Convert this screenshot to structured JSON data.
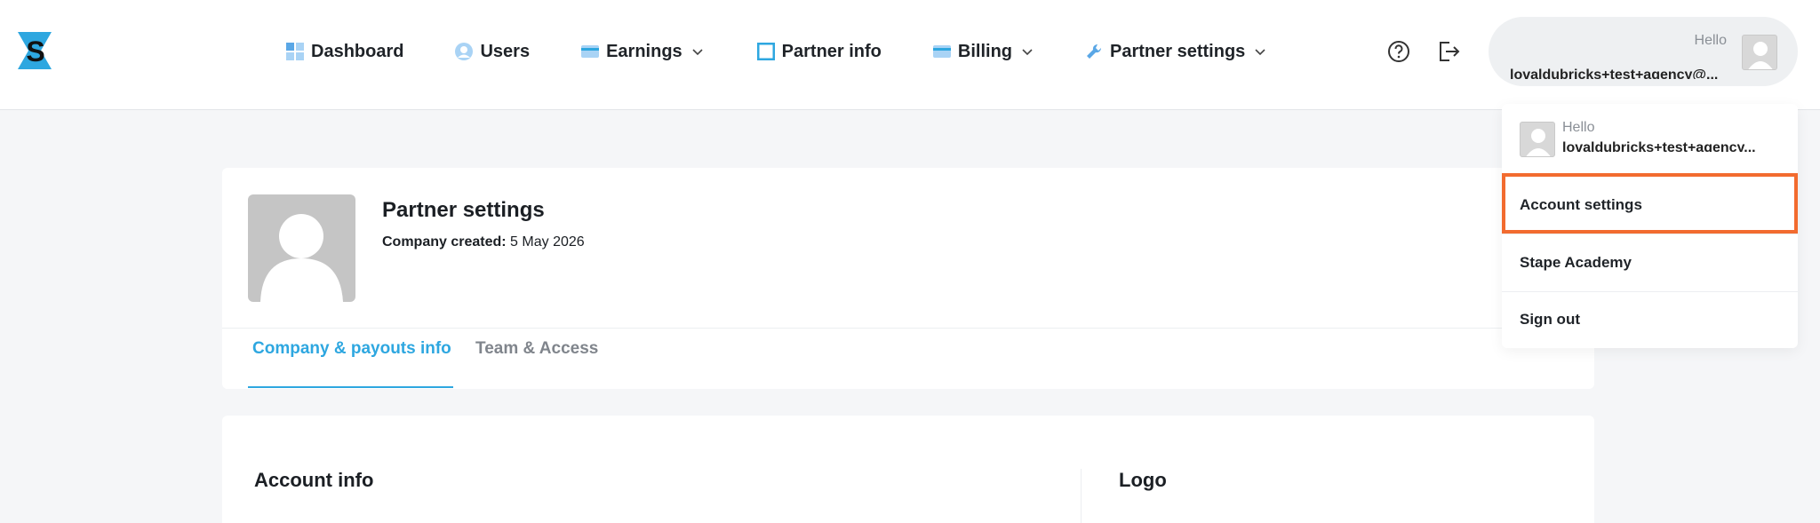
{
  "nav": {
    "dashboard": "Dashboard",
    "users": "Users",
    "earnings": "Earnings",
    "partner_info": "Partner info",
    "billing": "Billing",
    "partner_settings": "Partner settings"
  },
  "user": {
    "hello": "Hello",
    "email": "lovaldubricks+test+agency@...",
    "email_short": "lovaldubricks+test+agency..."
  },
  "dropdown": {
    "items": [
      "Account settings",
      "Stape Academy",
      "Sign out"
    ]
  },
  "page": {
    "title": "Partner settings",
    "company_created_label": "Company created:",
    "company_created_value": "5 May 2026"
  },
  "tabs": [
    "Company & payouts info",
    "Team & Access"
  ],
  "sections": {
    "account_info": "Account info",
    "logo": "Logo"
  },
  "colors": {
    "accent": "#2ea7e0",
    "highlight": "#f26b2f"
  },
  "icons": {
    "help": "question-circle-icon",
    "logout": "logout-icon"
  }
}
